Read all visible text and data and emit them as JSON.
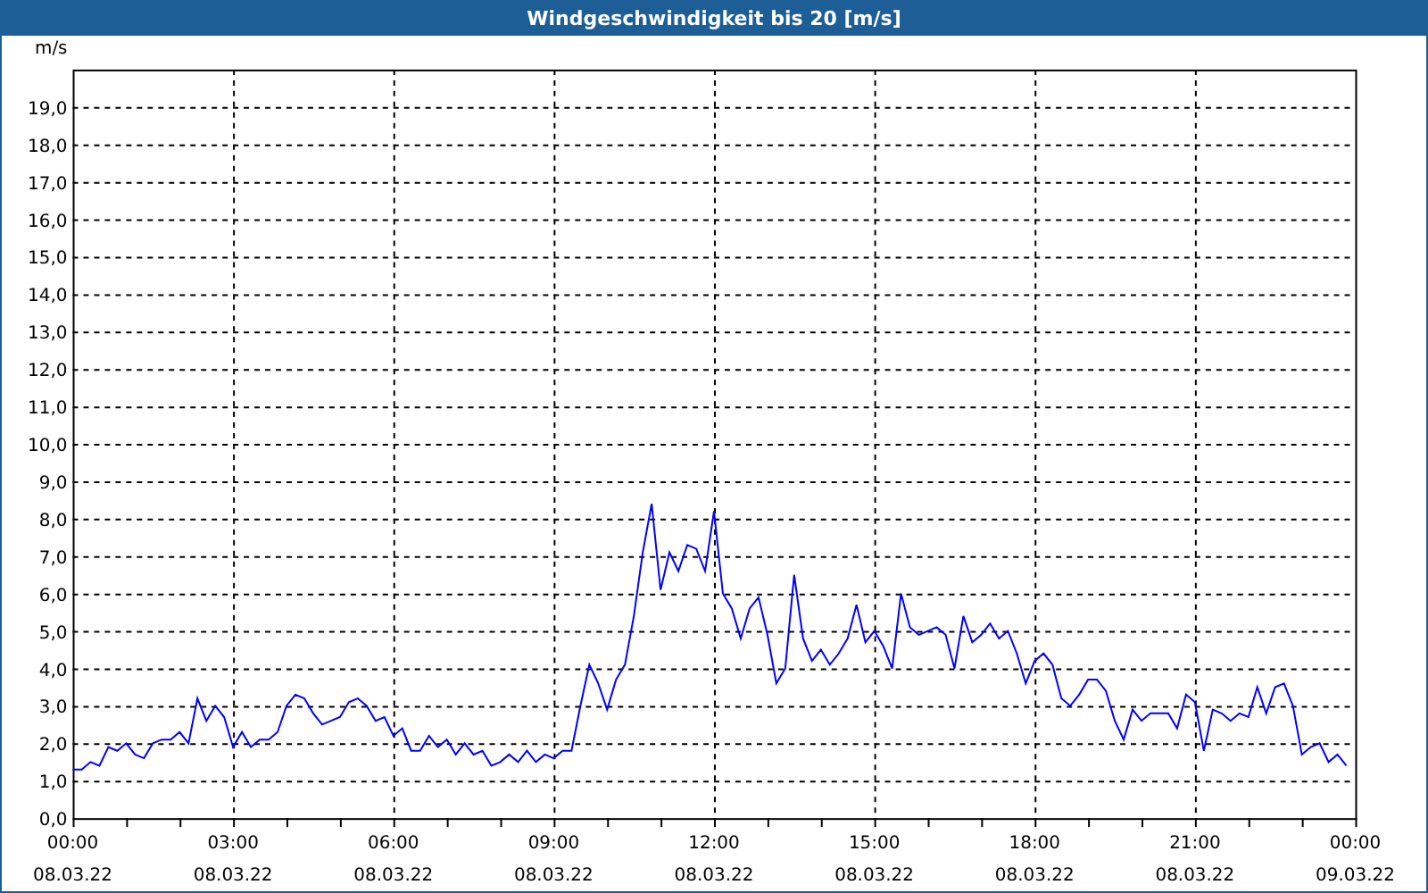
{
  "window": {
    "title": "Windgeschwindigkeit bis 20 [m/s]"
  },
  "chart": {
    "chart_data": {
      "type": "line",
      "ylabel": "m/s",
      "grid": true,
      "ylim": [
        0,
        20
      ],
      "categories": [
        "00:00\n08.03.22",
        null,
        null,
        null,
        null,
        null,
        null,
        null,
        null,
        null,
        null,
        null,
        null,
        null,
        null,
        null,
        null,
        null,
        "03:00\n08.03.22",
        null,
        null,
        null,
        null,
        null,
        null,
        null,
        null,
        null,
        null,
        null,
        null,
        null,
        null,
        null,
        null,
        null,
        "06:00\n08.03.22",
        null,
        null,
        null,
        null,
        null,
        null,
        null,
        null,
        null,
        null,
        null,
        null,
        null,
        null,
        null,
        null,
        null,
        "09:00\n08.03.22",
        null,
        null,
        null,
        null,
        null,
        null,
        null,
        null,
        null,
        null,
        null,
        null,
        null,
        null,
        null,
        null,
        null,
        "12:00\n08.03.22",
        null,
        null,
        null,
        null,
        null,
        null,
        null,
        null,
        null,
        null,
        null,
        null,
        null,
        null,
        null,
        null,
        null,
        "15:00\n08.03.22",
        null,
        null,
        null,
        null,
        null,
        null,
        null,
        null,
        null,
        null,
        null,
        null,
        null,
        null,
        null,
        null,
        null,
        "18:00\n08.03.22",
        null,
        null,
        null,
        null,
        null,
        null,
        null,
        null,
        null,
        null,
        null,
        null,
        null,
        null,
        null,
        null,
        null,
        "21:00\n08.03.22",
        null,
        null,
        null,
        null,
        null,
        null,
        null,
        null,
        null,
        null,
        null,
        null,
        null,
        null,
        null,
        null,
        null,
        "00:00\n09.03.22"
      ],
      "series": [
        {
          "color": "#0000ff",
          "values": [
            1.3,
            1.3,
            1.5,
            1.4,
            1.9,
            1.8,
            2.0,
            1.7,
            1.6,
            2.0,
            2.1,
            2.1,
            2.3,
            2.0,
            3.2,
            2.6,
            3.0,
            2.7,
            1.9,
            2.3,
            1.9,
            2.1,
            2.1,
            2.3,
            3.0,
            3.3,
            3.2,
            2.8,
            2.5,
            2.6,
            2.7,
            3.1,
            3.2,
            3.0,
            2.6,
            2.7,
            2.2,
            2.4,
            1.8,
            1.8,
            2.2,
            1.9,
            2.1,
            1.7,
            2.0,
            1.7,
            1.8,
            1.4,
            1.5,
            1.7,
            1.5,
            1.8,
            1.5,
            1.7,
            1.6,
            1.8,
            1.8,
            3.0,
            4.1,
            3.6,
            2.9,
            3.7,
            4.1,
            5.4,
            7.1,
            8.4,
            6.1,
            7.1,
            6.6,
            7.3,
            7.2,
            6.6,
            8.2,
            6.0,
            5.6,
            4.8,
            5.6,
            5.9,
            4.9,
            3.6,
            4.0,
            6.5,
            4.8,
            4.2,
            4.5,
            4.1,
            4.4,
            4.8,
            5.7,
            4.7,
            5.0,
            4.6,
            4.0,
            6.0,
            5.1,
            4.9,
            5.0,
            5.1,
            4.9,
            4.0,
            5.4,
            4.7,
            4.9,
            5.2,
            4.8,
            5.0,
            4.4,
            3.6,
            4.2,
            4.4,
            4.1,
            3.2,
            3.0,
            3.3,
            3.7,
            3.7,
            3.4,
            2.6,
            2.1,
            2.9,
            2.6,
            2.8,
            2.8,
            2.8,
            2.4,
            3.3,
            3.1,
            1.8,
            2.9,
            2.8,
            2.6,
            2.8,
            2.7,
            3.5,
            2.8,
            3.5,
            3.6,
            3.0,
            1.7,
            1.9,
            2.0,
            1.5,
            1.7,
            1.4,
            null
          ]
        }
      ],
      "yticks": [
        {
          "value": 0,
          "label": "0,0"
        },
        {
          "value": 1,
          "label": "1,0"
        },
        {
          "value": 2,
          "label": "2,0"
        },
        {
          "value": 3,
          "label": "3,0"
        },
        {
          "value": 4,
          "label": "4,0"
        },
        {
          "value": 5,
          "label": "5,0"
        },
        {
          "value": 6,
          "label": "6,0"
        },
        {
          "value": 7,
          "label": "7,0"
        },
        {
          "value": 8,
          "label": "8,0"
        },
        {
          "value": 9,
          "label": "9,0"
        },
        {
          "value": 10,
          "label": "10,0"
        },
        {
          "value": 11,
          "label": "11,0"
        },
        {
          "value": 12,
          "label": "12,0"
        },
        {
          "value": 13,
          "label": "13,0"
        },
        {
          "value": 14,
          "label": "14,0"
        },
        {
          "value": 15,
          "label": "15,0"
        },
        {
          "value": 16,
          "label": "16,0"
        },
        {
          "value": 17,
          "label": "17,0"
        },
        {
          "value": 18,
          "label": "18,0"
        },
        {
          "value": 19,
          "label": "19,0"
        }
      ]
    }
  }
}
